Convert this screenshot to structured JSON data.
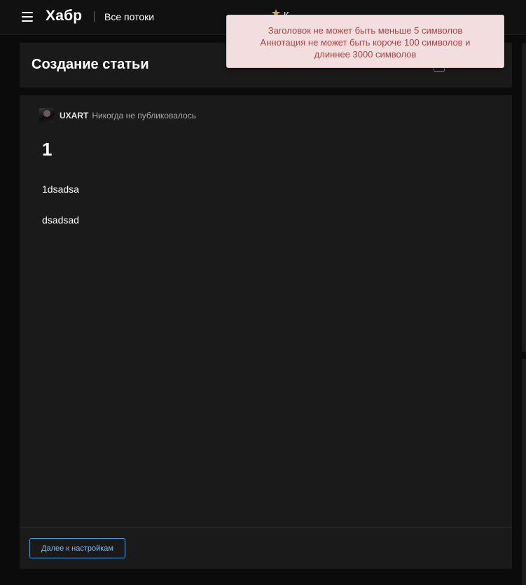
{
  "header": {
    "logo": "Хабр",
    "flows_label": "Все потоки",
    "festive_text": "К"
  },
  "page": {
    "title": "Создание статьи"
  },
  "editor": {
    "author_name": "UXART",
    "author_status": "Никогда не публиковалось",
    "article_title": "1",
    "paragraphs": [
      "1dsadsa",
      "dsadsad"
    ],
    "next_button_label": "Далее к настройкам"
  },
  "toast": {
    "lines": [
      "Заголовок не может быть меньше 5 символов",
      "Аннотация не может быть короче 100 символов и",
      "длиннее 3000 символов"
    ]
  },
  "colors": {
    "background": "#0b0b0b",
    "card": "#1a1a1a",
    "accent": "#4a9fe0",
    "error_text": "#a94442",
    "error_bg": "#f2dedf"
  },
  "icons": [
    "menu-icon",
    "festive-icon",
    "avatar"
  ]
}
